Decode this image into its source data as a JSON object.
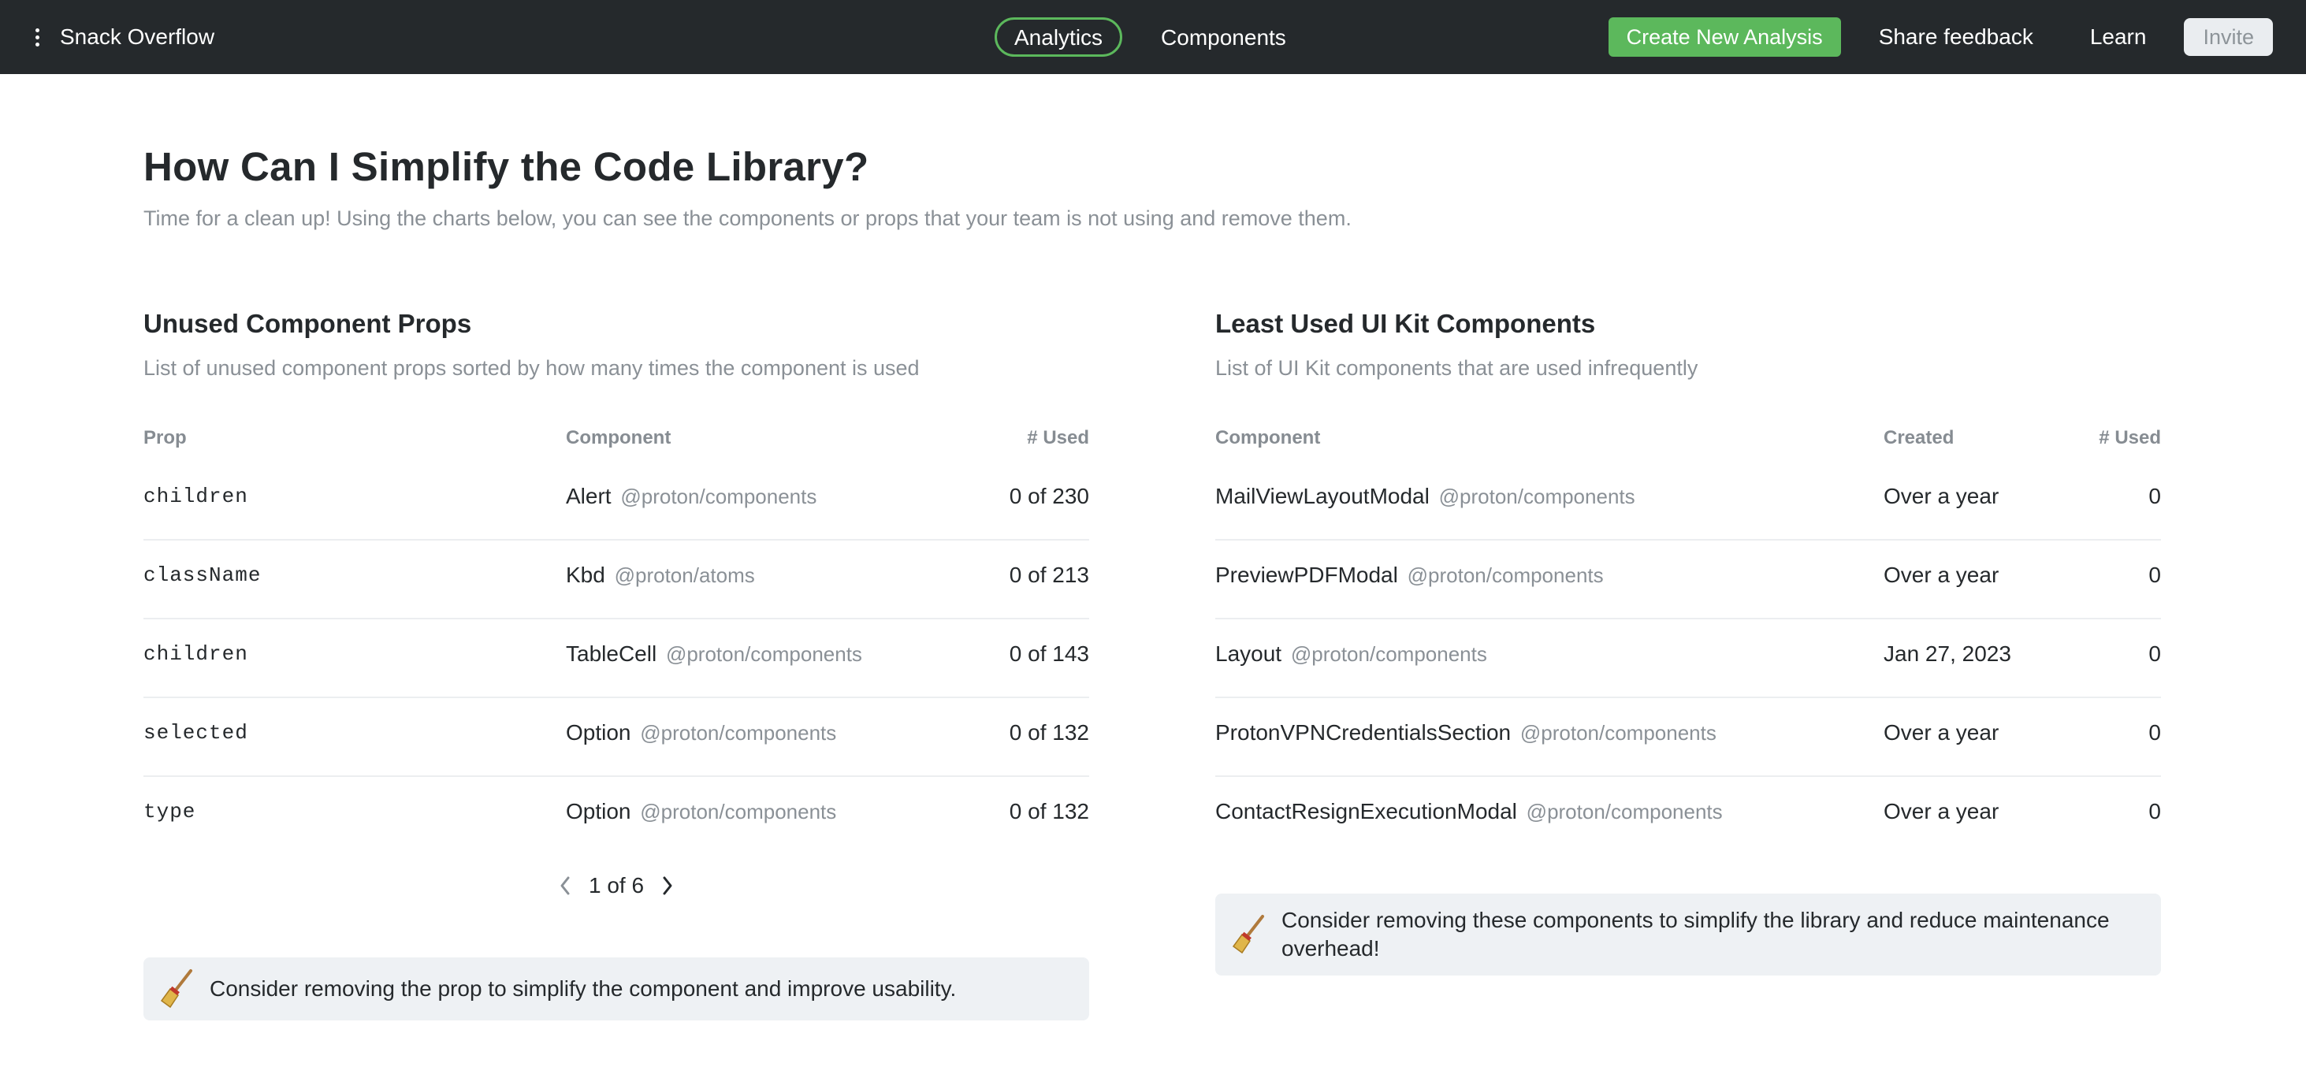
{
  "topbar": {
    "brand": "Snack Overflow",
    "tabs": [
      {
        "label": "Analytics",
        "active": true
      },
      {
        "label": "Components",
        "active": false
      }
    ],
    "create_button": "Create New Analysis",
    "share_feedback": "Share feedback",
    "learn": "Learn",
    "invite": "Invite"
  },
  "page": {
    "title": "How Can I Simplify the Code Library?",
    "subtitle": "Time for a clean up! Using the charts below, you can see the components or props that your team is not using and remove them."
  },
  "unused_props": {
    "title": "Unused Component Props",
    "subtitle": "List of unused component props sorted by how many times the component is used",
    "columns": {
      "prop": "Prop",
      "component": "Component",
      "used": "# Used"
    },
    "rows": [
      {
        "prop": "children",
        "component": "Alert",
        "package": "@proton/components",
        "used": "0 of 230"
      },
      {
        "prop": "className",
        "component": "Kbd",
        "package": "@proton/atoms",
        "used": "0 of 213"
      },
      {
        "prop": "children",
        "component": "TableCell",
        "package": "@proton/components",
        "used": "0 of 143"
      },
      {
        "prop": "selected",
        "component": "Option",
        "package": "@proton/components",
        "used": "0 of 132"
      },
      {
        "prop": "type",
        "component": "Option",
        "package": "@proton/components",
        "used": "0 of 132"
      }
    ],
    "pagination": {
      "label": "1 of 6"
    },
    "tip": "Consider removing the prop to simplify the component and improve usability."
  },
  "least_used": {
    "title": "Least Used UI Kit Components",
    "subtitle": "List of UI Kit components that are used infrequently",
    "columns": {
      "component": "Component",
      "created": "Created",
      "used": "# Used"
    },
    "rows": [
      {
        "component": "MailViewLayoutModal",
        "package": "@proton/components",
        "created": "Over a year",
        "used": "0"
      },
      {
        "component": "PreviewPDFModal",
        "package": "@proton/components",
        "created": "Over a year",
        "used": "0"
      },
      {
        "component": "Layout",
        "package": "@proton/components",
        "created": "Jan 27, 2023",
        "used": "0"
      },
      {
        "component": "ProtonVPNCredentialsSection",
        "package": "@proton/components",
        "created": "Over a year",
        "used": "0"
      },
      {
        "component": "ContactResignExecutionModal",
        "package": "@proton/components",
        "created": "Over a year",
        "used": "0"
      }
    ],
    "tip": "Consider removing these components to simplify the library and reduce maintenance overhead!"
  },
  "colors": {
    "topbar": "#25292c",
    "accent_green": "#5cb85c",
    "muted_text": "#8a9096",
    "tip_background": "#eef1f4"
  },
  "icons": {
    "menu": "kebab-menu-icon",
    "prev": "chevron-left-icon",
    "next": "chevron-right-icon",
    "tip": "broom-icon"
  }
}
